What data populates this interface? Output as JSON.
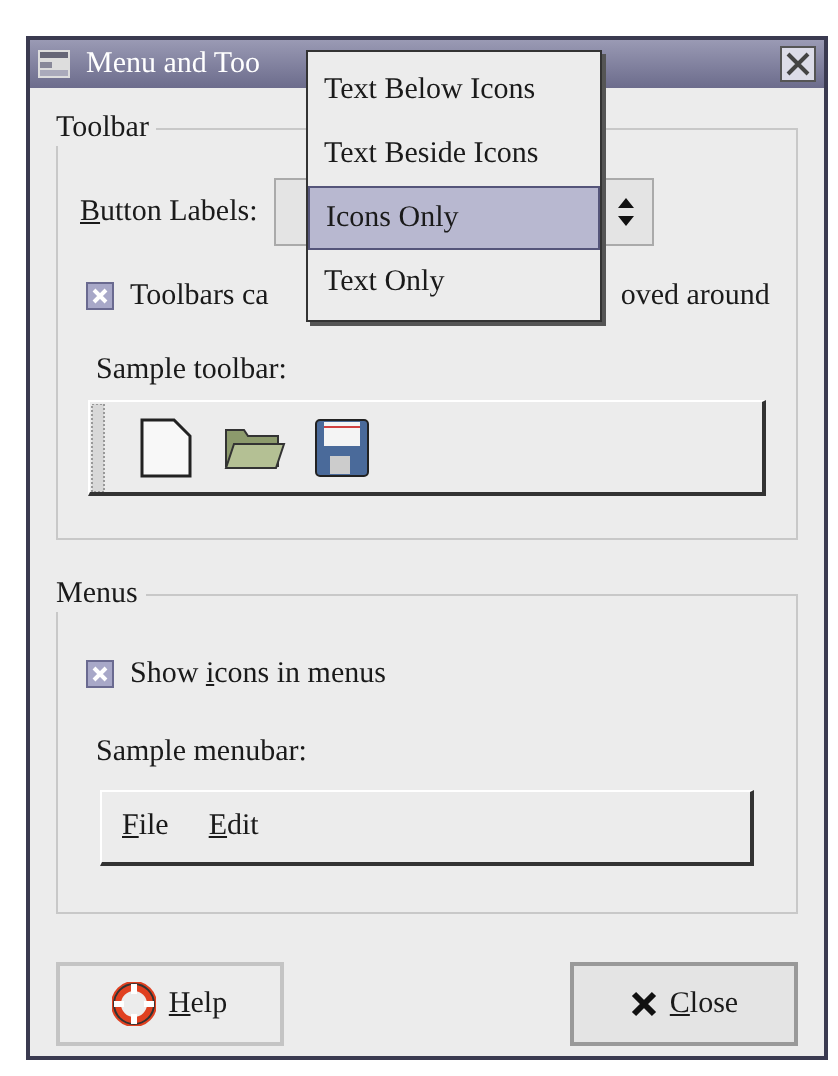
{
  "window": {
    "title": "Menu and Too"
  },
  "toolbar_section": {
    "title": "Toolbar",
    "button_labels": {
      "label": {
        "key": "B",
        "after": "utton Labels:"
      }
    },
    "detachable_checkbox": {
      "checked": true,
      "label_start": "Toolbars ca",
      "label_end": "oved around"
    },
    "sample_label": "Sample toolbar:"
  },
  "menus_section": {
    "title": "Menus",
    "icons_checkbox": {
      "checked": true,
      "label": {
        "before": "Show ",
        "key": "i",
        "after": "cons in menus"
      }
    },
    "sample_label": "Sample menubar:",
    "menubar": [
      {
        "key": "F",
        "after": "ile"
      },
      {
        "key": "E",
        "after": "dit"
      }
    ]
  },
  "dropdown_menu": [
    {
      "label": "Text Below Icons",
      "selected": false
    },
    {
      "label": "Text Beside Icons",
      "selected": false
    },
    {
      "label": "Icons Only",
      "selected": true
    },
    {
      "label": "Text Only",
      "selected": false
    }
  ],
  "buttons": [
    {
      "kind": "help",
      "label": {
        "key": "H",
        "after": "elp"
      }
    },
    {
      "kind": "close",
      "label": {
        "key": "C",
        "after": "lose"
      }
    }
  ]
}
